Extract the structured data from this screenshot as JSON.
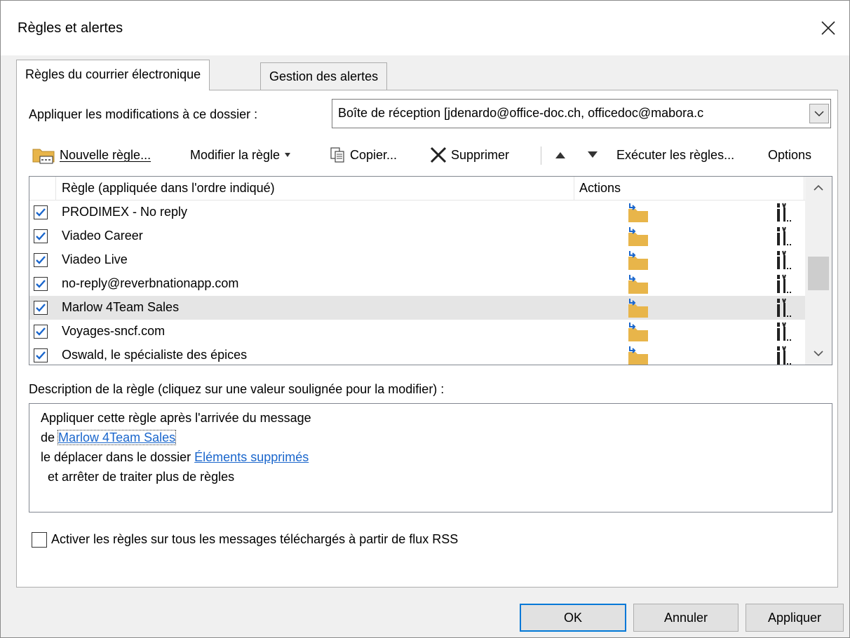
{
  "window": {
    "title": "Règles et alertes"
  },
  "tabs": [
    {
      "label": "Règles du courrier électronique",
      "active": true
    },
    {
      "label": "Gestion des alertes",
      "active": false
    }
  ],
  "apply_folder": {
    "label": "Appliquer les modifications à ce dossier :",
    "value": "Boîte de réception [jdenardo@office-doc.ch, officedoc@mabora.c"
  },
  "toolbar": {
    "new_rule": "Nouvelle règle...",
    "modify_rule": "Modifier la règle",
    "copy": "Copier...",
    "delete": "Supprimer",
    "run_rules": "Exécuter les règles...",
    "options": "Options"
  },
  "rules_list": {
    "col_rule": "Règle (appliquée dans l'ordre indiqué)",
    "col_actions": "Actions",
    "rows": [
      {
        "name": "PRODIMEX - No reply",
        "checked": true,
        "selected": false
      },
      {
        "name": "Viadeo Career",
        "checked": true,
        "selected": false
      },
      {
        "name": "Viadeo Live",
        "checked": true,
        "selected": false
      },
      {
        "name": "no-reply@reverbnationapp.com",
        "checked": true,
        "selected": false
      },
      {
        "name": "Marlow 4Team Sales",
        "checked": true,
        "selected": true
      },
      {
        "name": "Voyages-sncf.com",
        "checked": true,
        "selected": false
      },
      {
        "name": "Oswald, le spécialiste des épices",
        "checked": true,
        "selected": false
      }
    ]
  },
  "description": {
    "label": "Description de la règle (cliquez sur une valeur soulignée pour la modifier) :",
    "line1": "Appliquer cette règle après l'arrivée du message",
    "line2_prefix": "de",
    "line2_link": "Marlow 4Team Sales",
    "line3_prefix": "le déplacer dans le dossier",
    "line3_link": "Éléments supprimés",
    "line4": "et arrêter de traiter plus de règles"
  },
  "rss": {
    "label": "Activer les règles sur tous les messages téléchargés à partir de flux RSS",
    "checked": false
  },
  "buttons": {
    "ok": "OK",
    "cancel": "Annuler",
    "apply": "Appliquer"
  },
  "colors": {
    "link": "#1a66cc",
    "focus_border": "#0078d7",
    "checkbox": "#1a66cc",
    "folder": "#e8b54a"
  }
}
